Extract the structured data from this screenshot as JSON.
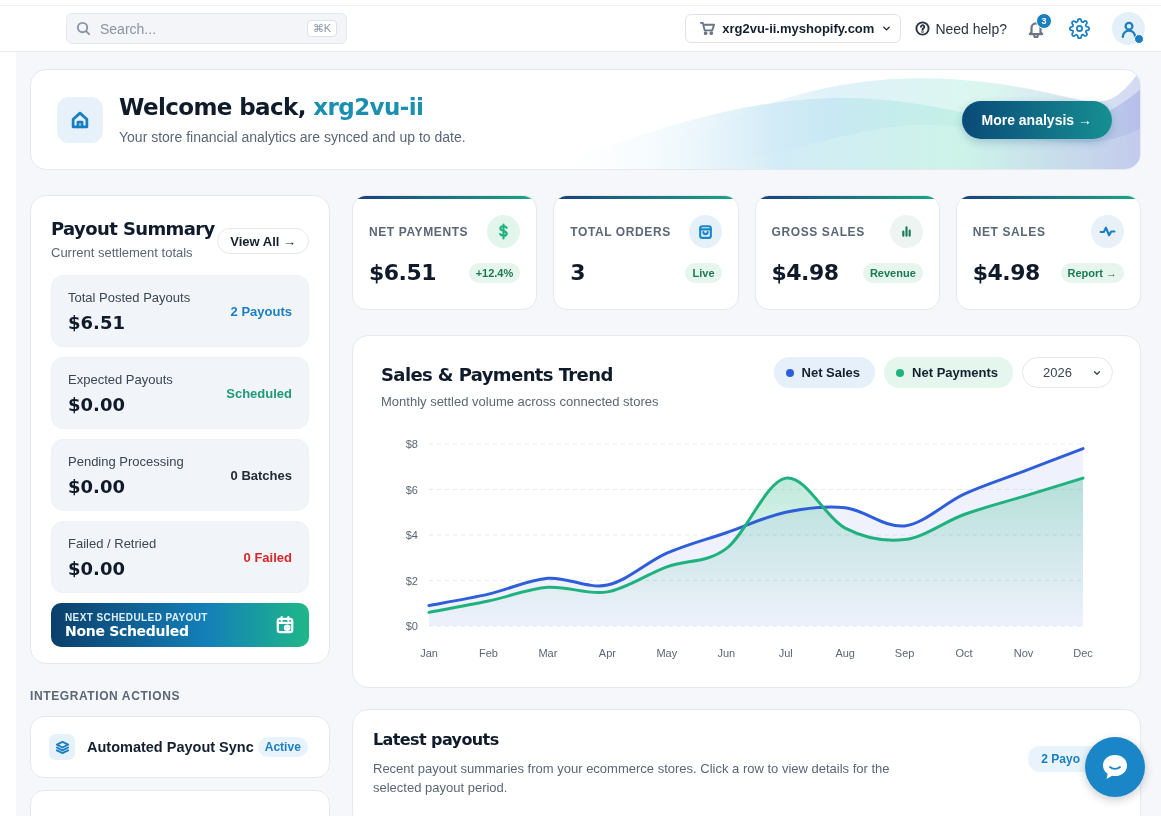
{
  "topbar": {
    "search": {
      "placeholder": "Search...",
      "shortcut": "⌘K"
    },
    "store": "xrg2vu-ii.myshopify.com",
    "help": "Need help?",
    "notifications": "3"
  },
  "welcome": {
    "greeting": "Welcome back, ",
    "user": "xrg2vu-ii",
    "subtitle": "Your store financial analytics are synced and up to date.",
    "button": "More analysis →"
  },
  "payout_summary": {
    "title": "Payout Summary",
    "subtitle": "Current settlement totals",
    "button": "View All →",
    "items": [
      {
        "label": "Total Posted Payouts",
        "amount": "$6.51",
        "status": "2 Payouts",
        "color": "#1a7fc1"
      },
      {
        "label": "Expected Payouts",
        "amount": "$0.00",
        "status": "Scheduled",
        "color": "#1f9a78"
      },
      {
        "label": "Pending Processing",
        "amount": "$0.00",
        "status": "0 Batches",
        "color": "#222b38"
      },
      {
        "label": "Failed / Retried",
        "amount": "$0.00",
        "status": "0 Failed",
        "color": "#d62828"
      }
    ],
    "next": {
      "label": "NEXT SCHEDULED PAYOUT",
      "value": "None Scheduled"
    }
  },
  "stats": [
    {
      "kind": "payments",
      "label": "NET PAYMENTS",
      "value": "$6.51",
      "badge": "+12.4%"
    },
    {
      "kind": "orders",
      "label": "TOTAL ORDERS",
      "value": "3",
      "badge": "Live"
    },
    {
      "kind": "gross",
      "label": "GROSS SALES",
      "value": "$4.98",
      "badge": "Revenue"
    },
    {
      "kind": "net",
      "label": "NET SALES",
      "value": "$4.98",
      "badge": "Report →"
    }
  ],
  "trend": {
    "title": "Sales & Payments Trend",
    "subtitle": "Monthly settled volume across connected stores",
    "year": "2026",
    "chart_data": {
      "type": "area",
      "grid": true,
      "categories": [
        "Jan",
        "Feb",
        "Mar",
        "Apr",
        "May",
        "Jun",
        "Jul",
        "Aug",
        "Sep",
        "Oct",
        "Nov",
        "Dec"
      ],
      "series": [
        {
          "name": "Net Sales",
          "color": "#2f5fd8",
          "values": [
            0.9,
            1.4,
            2.1,
            1.8,
            3.2,
            4.1,
            5.0,
            5.2,
            4.4,
            5.8,
            6.8,
            7.8
          ]
        },
        {
          "name": "Net Payments",
          "color": "#1fb27e",
          "values": [
            0.6,
            1.1,
            1.7,
            1.5,
            2.6,
            3.4,
            6.5,
            4.3,
            3.8,
            4.9,
            5.7,
            6.5
          ]
        }
      ],
      "ylim": [
        0,
        8
      ],
      "yticks": [
        {
          "value": 0,
          "label": "$0"
        },
        {
          "value": 2,
          "label": "$2"
        },
        {
          "value": 4,
          "label": "$4"
        },
        {
          "value": 6,
          "label": "$6"
        },
        {
          "value": 8,
          "label": "$8"
        }
      ]
    }
  },
  "integrations": {
    "title": "INTEGRATION ACTIONS",
    "items": [
      {
        "label": "Automated Payout Sync",
        "status": "Active"
      }
    ]
  },
  "latest_payouts": {
    "title": "Latest payouts",
    "description": "Recent payout summaries from your ecommerce stores. Click a row to view details for the selected payout period.",
    "badge": "2 Payo"
  }
}
